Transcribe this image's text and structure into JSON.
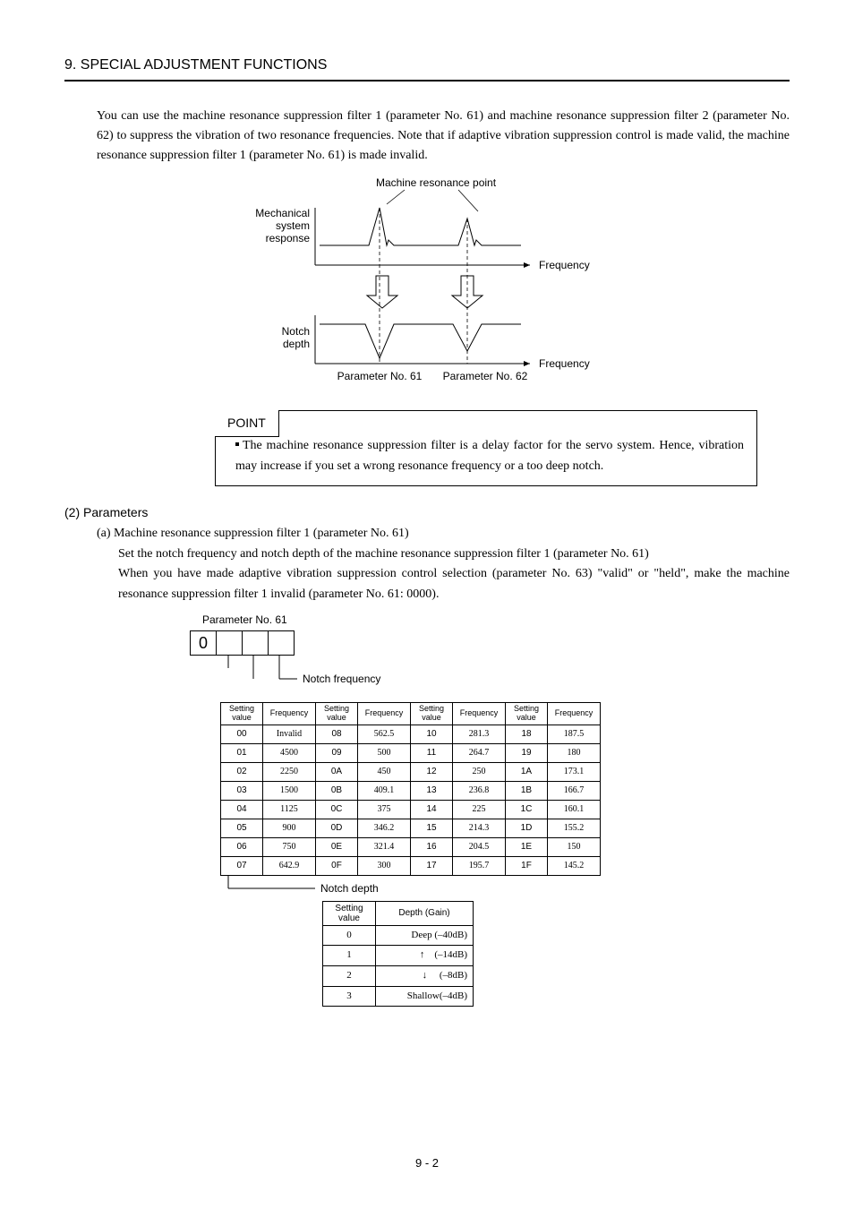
{
  "header": {
    "title": "9. SPECIAL ADJUSTMENT FUNCTIONS"
  },
  "intro": "You can use the machine resonance suppression filter 1 (parameter No. 61) and machine resonance suppression filter 2 (parameter No. 62) to suppress the vibration of two resonance frequencies. Note that if adaptive vibration suppression control is made valid, the machine resonance suppression filter 1 (parameter No. 61) is made invalid.",
  "diagram": {
    "resonance_point": "Machine resonance point",
    "mechanical_label_1": "Mechanical",
    "mechanical_label_2": "system",
    "mechanical_label_3": "response",
    "frequency": "Frequency",
    "notch_label_1": "Notch",
    "notch_label_2": "depth",
    "param61": "Parameter No. 61",
    "param62": "Parameter No. 62"
  },
  "point": {
    "label": "POINT",
    "text": "The machine resonance suppression filter is a delay factor for the servo system. Hence, vibration may increase if you set a wrong resonance frequency or a too deep notch."
  },
  "section2": {
    "heading": "(2) Parameters",
    "a_heading": "(a) Machine resonance suppression filter 1 (parameter No. 61)",
    "a_body_1": "Set the notch frequency and notch depth of the machine resonance suppression filter 1 (parameter No. 61)",
    "a_body_2": "When you have made adaptive vibration suppression control selection (parameter No. 63) \"valid\" or \"held\", make the machine resonance suppression filter 1 invalid (parameter No. 61: 0000)."
  },
  "param_block": {
    "title": "Parameter No. 61",
    "digit0": "0",
    "notch_freq_label": "Notch frequency",
    "notch_depth_label": "Notch depth",
    "hdr_setting": "Setting\nvalue",
    "hdr_freq": "Frequency",
    "freq_rows": [
      {
        "a": "00",
        "af": "Invalid",
        "b": "08",
        "bf": "562.5",
        "c": "10",
        "cf": "281.3",
        "d": "18",
        "df": "187.5"
      },
      {
        "a": "01",
        "af": "4500",
        "b": "09",
        "bf": "500",
        "c": "11",
        "cf": "264.7",
        "d": "19",
        "df": "180"
      },
      {
        "a": "02",
        "af": "2250",
        "b": "0A",
        "bf": "450",
        "c": "12",
        "cf": "250",
        "d": "1A",
        "df": "173.1"
      },
      {
        "a": "03",
        "af": "1500",
        "b": "0B",
        "bf": "409.1",
        "c": "13",
        "cf": "236.8",
        "d": "1B",
        "df": "166.7"
      },
      {
        "a": "04",
        "af": "1125",
        "b": "0C",
        "bf": "375",
        "c": "14",
        "cf": "225",
        "d": "1C",
        "df": "160.1"
      },
      {
        "a": "05",
        "af": "900",
        "b": "0D",
        "bf": "346.2",
        "c": "15",
        "cf": "214.3",
        "d": "1D",
        "df": "155.2"
      },
      {
        "a": "06",
        "af": "750",
        "b": "0E",
        "bf": "321.4",
        "c": "16",
        "cf": "204.5",
        "d": "1E",
        "df": "150"
      },
      {
        "a": "07",
        "af": "642.9",
        "b": "0F",
        "bf": "300",
        "c": "17",
        "cf": "195.7",
        "d": "1F",
        "df": "145.2"
      }
    ],
    "depth_hdr_setting": "Setting\nvalue",
    "depth_hdr_gain": "Depth (Gain)",
    "depth_rows": [
      {
        "v": "0",
        "g": "Deep (–40dB)"
      },
      {
        "v": "1",
        "g": "↑    (–14dB)"
      },
      {
        "v": "2",
        "g": "↓     (–8dB)"
      },
      {
        "v": "3",
        "g": "Shallow(–4dB)"
      }
    ]
  },
  "footer": "9 -  2"
}
